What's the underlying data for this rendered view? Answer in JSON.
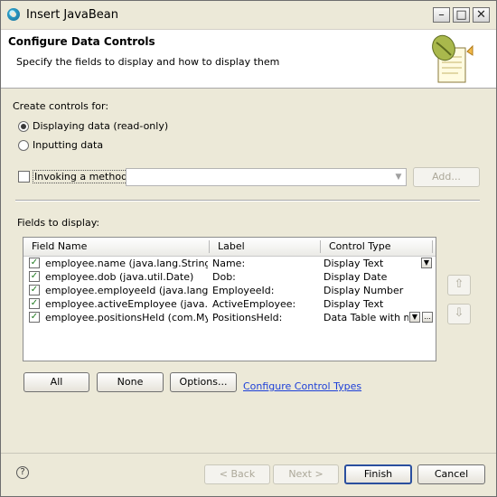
{
  "window": {
    "title": "Insert JavaBean"
  },
  "header": {
    "title": "Configure Data Controls",
    "subtitle": "Specify the fields to display and how to display them"
  },
  "create_controls": {
    "label": "Create controls for:",
    "options": [
      {
        "label": "Displaying data (read-only)",
        "selected": true
      },
      {
        "label": "Inputting data",
        "selected": false
      }
    ],
    "invoke_method": {
      "label": "Invoking a method:",
      "checked": false,
      "value": ""
    },
    "add_button": "Add..."
  },
  "fields": {
    "label": "Fields to display:",
    "columns": [
      "Field Name",
      "Label",
      "Control Type"
    ],
    "rows": [
      {
        "field": "employee.name (java.lang.String)",
        "label": "Name:",
        "control": "Display Text",
        "checked": true
      },
      {
        "field": "employee.dob (java.util.Date)",
        "label": "Dob:",
        "control": "Display Date",
        "checked": true
      },
      {
        "field": "employee.employeeId (java.lang.Integer)",
        "label": "EmployeeId:",
        "control": "Display Number",
        "checked": true
      },
      {
        "field": "employee.activeEmployee (java.lang.Boolean)",
        "label": "ActiveEmployee:",
        "control": "Display Text",
        "checked": true
      },
      {
        "field": "employee.positionsHeld (com.MyCompany.Position)",
        "label": "PositionsHeld:",
        "control": "Data Table with multiple columns",
        "checked": true
      }
    ]
  },
  "buttons": {
    "all": "All",
    "none": "None",
    "options": "Options...",
    "configure_link": "Configure Control Types",
    "back": "< Back",
    "next": "Next >",
    "finish": "Finish",
    "cancel": "Cancel"
  },
  "icons": {
    "app": "eclipse-icon",
    "minimize": "minimize-icon",
    "maximize": "maximize-icon",
    "close": "close-icon",
    "help": "help-icon",
    "move_up": "arrow-up-icon",
    "move_down": "arrow-down-icon",
    "wizard": "javabean-wizard-icon"
  }
}
